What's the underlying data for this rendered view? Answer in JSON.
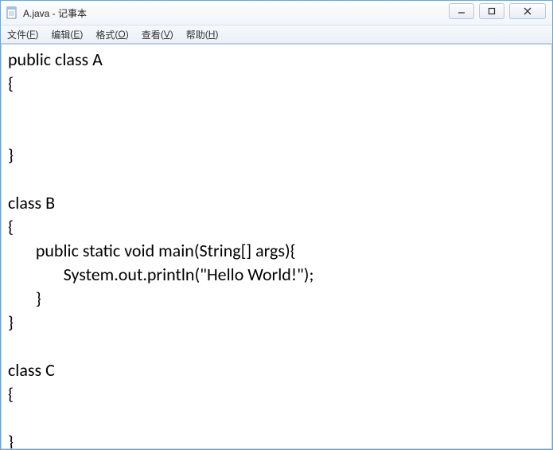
{
  "window": {
    "title": "A.java - 记事本"
  },
  "menu": {
    "file": {
      "label": "文件",
      "accel": "F"
    },
    "edit": {
      "label": "编辑",
      "accel": "E"
    },
    "format": {
      "label": "格式",
      "accel": "O"
    },
    "view": {
      "label": "查看",
      "accel": "V"
    },
    "help": {
      "label": "帮助",
      "accel": "H"
    }
  },
  "editor": {
    "text": "public class A\n{\n\n\n}\n\nclass B\n{\n       public static void main(String[] args){\n              System.out.println(\"Hello World!\");\n       }\n}\n\nclass C\n{\n\n}"
  }
}
